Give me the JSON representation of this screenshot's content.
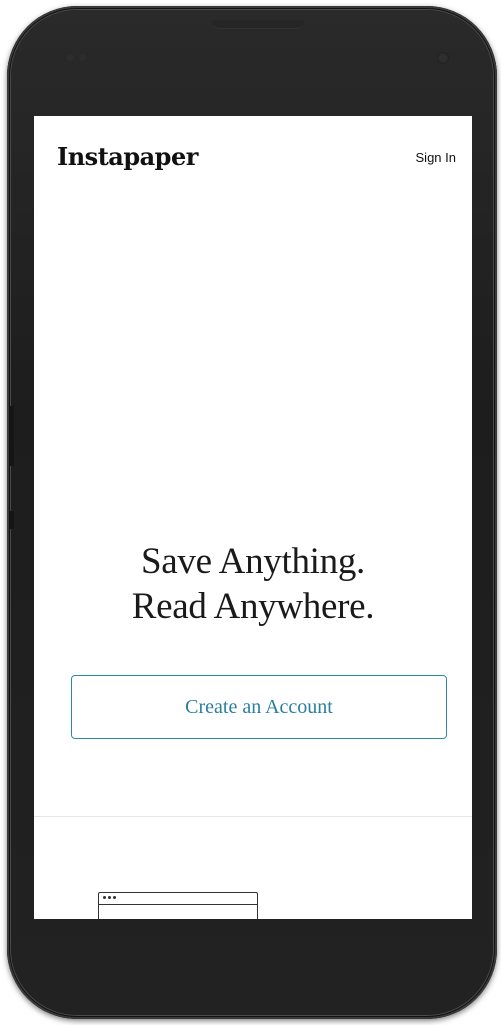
{
  "app": {
    "logo": "Instapaper",
    "sign_in_label": "Sign In"
  },
  "hero": {
    "line1": "Save Anything.",
    "line2": "Read Anywhere."
  },
  "cta": {
    "label": "Create an Account"
  },
  "colors": {
    "accent": "#2c89a8",
    "text": "#1a1a1a",
    "device_body": "#222222"
  },
  "icons": {
    "browser_illustration": "browser-window-icon"
  }
}
